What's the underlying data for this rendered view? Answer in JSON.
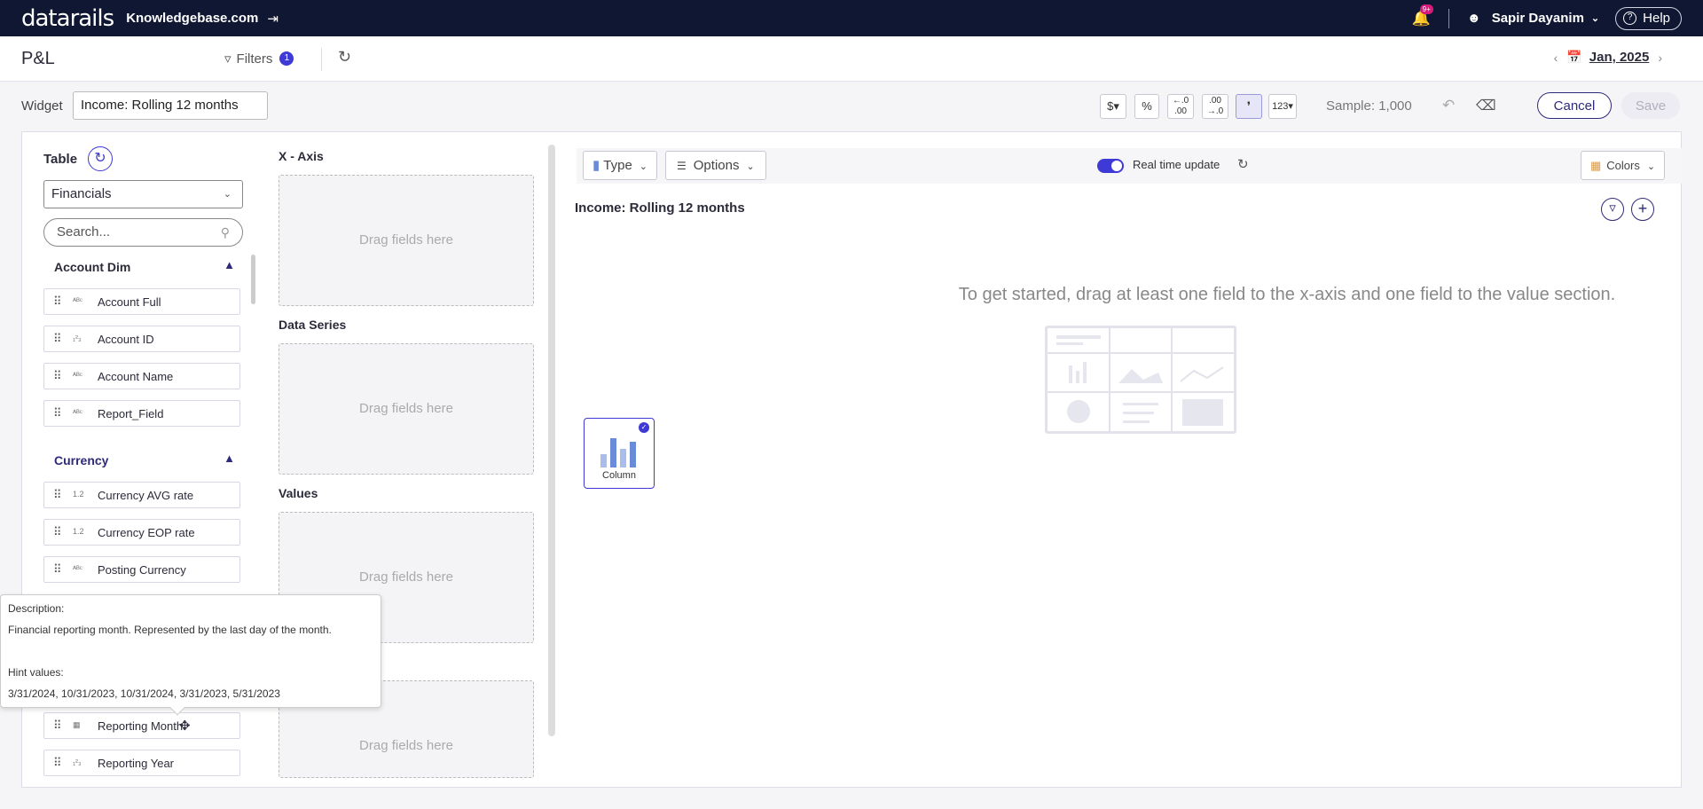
{
  "topbar": {
    "logo": "datarails",
    "site": "Knowledgebase.com",
    "notif_badge": "9+",
    "user_name": "Sapir Dayanim",
    "help_label": "Help"
  },
  "header": {
    "page_title": "P&L",
    "filters_label": "Filters",
    "filters_count": "1",
    "date": "Jan, 2025"
  },
  "widget_bar": {
    "widget_label": "Widget",
    "widget_name": "Income: Rolling 12 months",
    "format_buttons": [
      "$▾",
      "%",
      "←.0 .00",
      ".00 →.0",
      "❜",
      "123▾"
    ],
    "sample": "Sample: 1,000",
    "cancel": "Cancel",
    "save": "Save"
  },
  "left_panel": {
    "table_label": "Table",
    "table_select": "Financials",
    "search_placeholder": "Search...",
    "sections": [
      {
        "title": "Account Dim",
        "fields": [
          {
            "type": "ABC",
            "label": "Account Full"
          },
          {
            "type": "123",
            "label": "Account ID"
          },
          {
            "type": "ABC",
            "label": "Account Name"
          },
          {
            "type": "ABC",
            "label": "Report_Field"
          }
        ]
      },
      {
        "title": "Currency",
        "fields": [
          {
            "type": "1.2",
            "label": "Currency AVG rate"
          },
          {
            "type": "1.2",
            "label": "Currency EOP rate"
          },
          {
            "type": "ABC",
            "label": "Posting Currency"
          }
        ]
      }
    ],
    "visible_below": [
      {
        "type": "cal",
        "label": "Reporting Month"
      },
      {
        "type": "123",
        "label": "Reporting Year"
      }
    ]
  },
  "tooltip": {
    "desc_title": "Description:",
    "desc_text": "Financial reporting month. Represented by the last day of the month.",
    "hint_title": "Hint values:",
    "hint_text": "3/31/2024, 10/31/2023, 10/31/2024, 3/31/2023, 5/31/2023"
  },
  "zones": {
    "xaxis": "X - Axis",
    "series": "Data Series",
    "values": "Values",
    "drag": "Drag fields here"
  },
  "chart_panel": {
    "type_btn": "Type",
    "options_btn": "Options",
    "realtime_label": "Real time update",
    "realtime_on": true,
    "colors_btn": "Colors",
    "chart_title": "Income: Rolling 12 months",
    "empty_hint": "To get started, drag at least one field to the x-axis and one field to the value section.",
    "chart_type_card": "Column"
  },
  "colors": {
    "accent": "#3f3ad6",
    "topbar": "#0f1733"
  }
}
